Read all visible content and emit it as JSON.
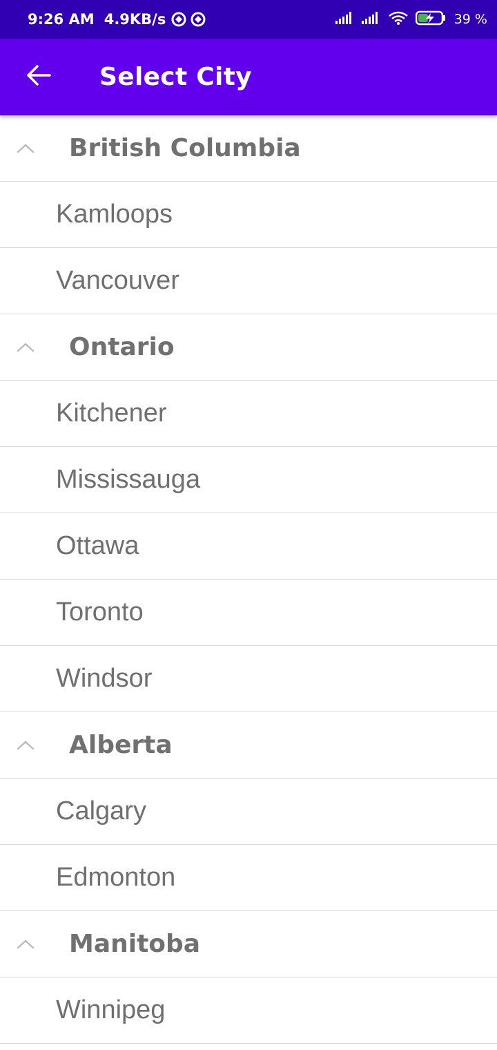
{
  "status_bar": {
    "time": "9:26 AM",
    "speed": "4.9KB/s",
    "battery": "39 %",
    "icons": [
      "sync-icon",
      "sync-icon",
      "signal-icon",
      "signal-icon",
      "wifi-icon",
      "battery-charging-icon"
    ]
  },
  "app_bar": {
    "title": "Select City",
    "back_icon": "arrow-left-icon",
    "color": "#6200ee"
  },
  "groups": [
    {
      "name": "British Columbia",
      "expanded": true,
      "cities": [
        "Kamloops",
        "Vancouver"
      ]
    },
    {
      "name": "Ontario",
      "expanded": true,
      "cities": [
        "Kitchener",
        "Mississauga",
        "Ottawa",
        "Toronto",
        "Windsor"
      ]
    },
    {
      "name": "Alberta",
      "expanded": true,
      "cities": [
        "Calgary",
        "Edmonton"
      ]
    },
    {
      "name": "Manitoba",
      "expanded": true,
      "cities": [
        "Winnipeg"
      ]
    }
  ]
}
